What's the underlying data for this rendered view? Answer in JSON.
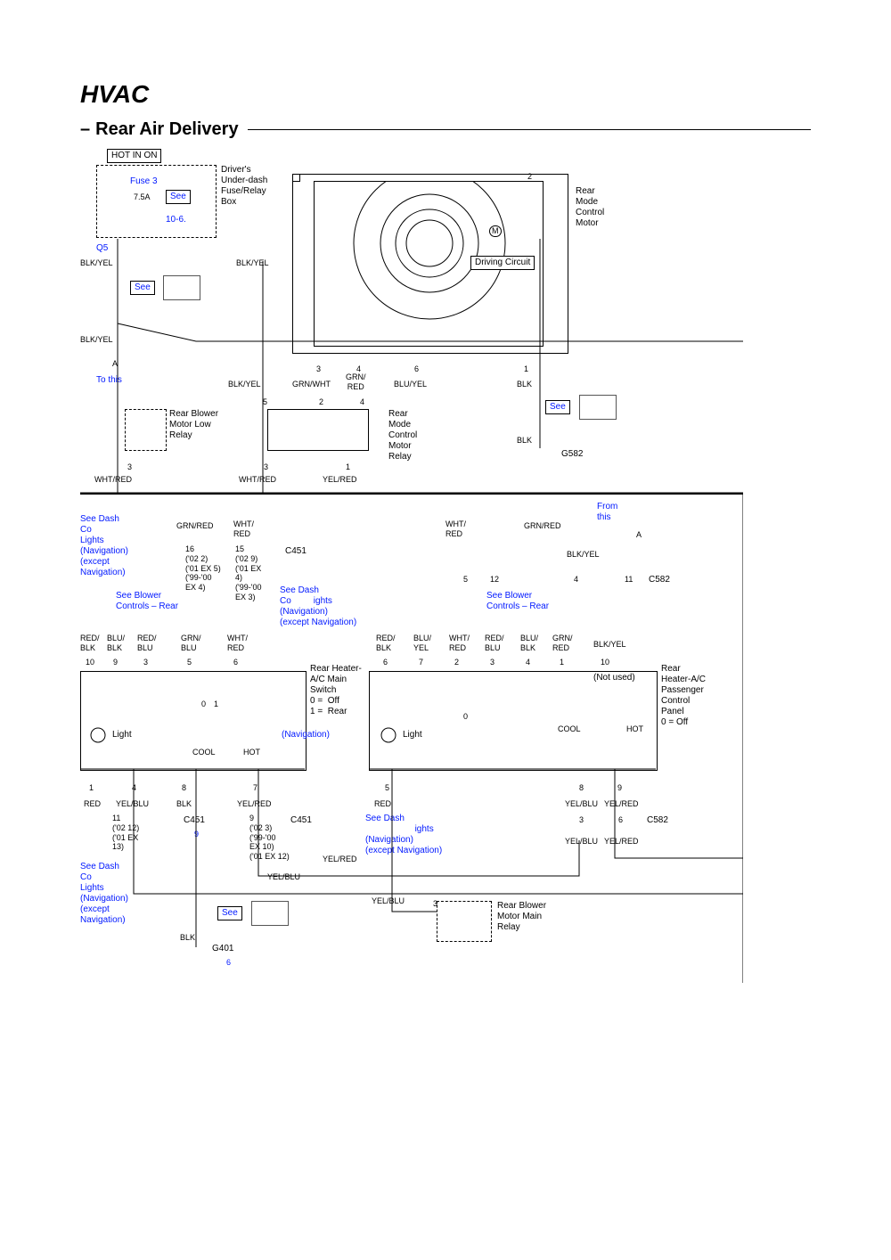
{
  "title": "HVAC",
  "subtitle": "Rear Air Delivery",
  "hotInOn": "HOT IN ON",
  "fuse3": "Fuse 3",
  "amp": "7.5A",
  "see": "See",
  "ref106": "10-6.",
  "driverBox": "Driver's\nUnder-dash\nFuse/Relay\nBox",
  "q5": "Q5",
  "blkyel": "BLK/YEL",
  "driving": "Driving Circuit",
  "m": "M",
  "toThis": "To this",
  "grnwht": "GRN/WHT",
  "grnred": "GRN/\nRED",
  "bluyel": "BLU/YEL",
  "blk": "BLK",
  "rearMode": "Rear\nMode\nControl\nMotor",
  "rearBlowerLow": "Rear Blower\nMotor Low\nRelay",
  "rearModeRelay": "Rear\nMode\nControl\nMotor\nRelay",
  "whtred": "WHT/RED",
  "yelred": "YEL/RED",
  "g582": "G582",
  "fromThis": "From\nthis",
  "seeDashCo": "See Dash\nCo\nLights\n(Navigation)\n(except\nNavigation)",
  "seeDashCoInline": "See Dash\nCo         ights\n(Navigation)\n(except Navigation)",
  "seeDashLights2": "See Dash\n                    ights\n(Navigation)\n(except Navigation)",
  "seeBlower": "See Blower\nControls – Rear",
  "c451": "C451",
  "c582": "C582",
  "grnredF": "GRN/RED",
  "whtredS": "WHT/\nRED",
  "pin16": "16\n('02 2)\n('01 EX 5)\n('99-'00\nEX 4)",
  "pin15": "15\n('02 9)\n('01 EX\n4)\n('99-'00\nEX 3)",
  "redblk": "RED/\nBLK",
  "blublk": "BLU/\nBLK",
  "redblu": "RED/\nBLU",
  "grnblu": "GRN/\nBLU",
  "bluyelS": "BLU/\nYEL",
  "grnredS": "GRN/\nRED",
  "rearHeaterSwitch": "Rear Heater-\nA/C Main\nSwitch\n0 =  Off\n1 =  Rear",
  "rearHeaterPanel": "Rear\nHeater-A/C\nPassenger\nControl\nPanel\n0 = Off",
  "light": "Light",
  "cool": "COOL",
  "hot": "HOT",
  "navigation": "(Navigation)",
  "notUsed": "(Not used)",
  "n10": "10",
  "n9": "9",
  "n3": "3",
  "n5": "5",
  "n6": "6",
  "n7": "7",
  "n2": "2",
  "n4": "4",
  "n1": "1",
  "n8": "8",
  "n12": "12",
  "n11": "11",
  "red": "RED",
  "yelblu": "YEL/BLU",
  "pin11": "11\n('02 12)\n('01 EX\n13)",
  "pin9b": "9\n('02 3)\n('99-'00\nEX 10)\n('01 EX 12)",
  "g401": "G401",
  "rearBlowerMain": "Rear Blower\nMotor Main\nRelay",
  "a": "A",
  "zero": "0",
  "one": "1"
}
